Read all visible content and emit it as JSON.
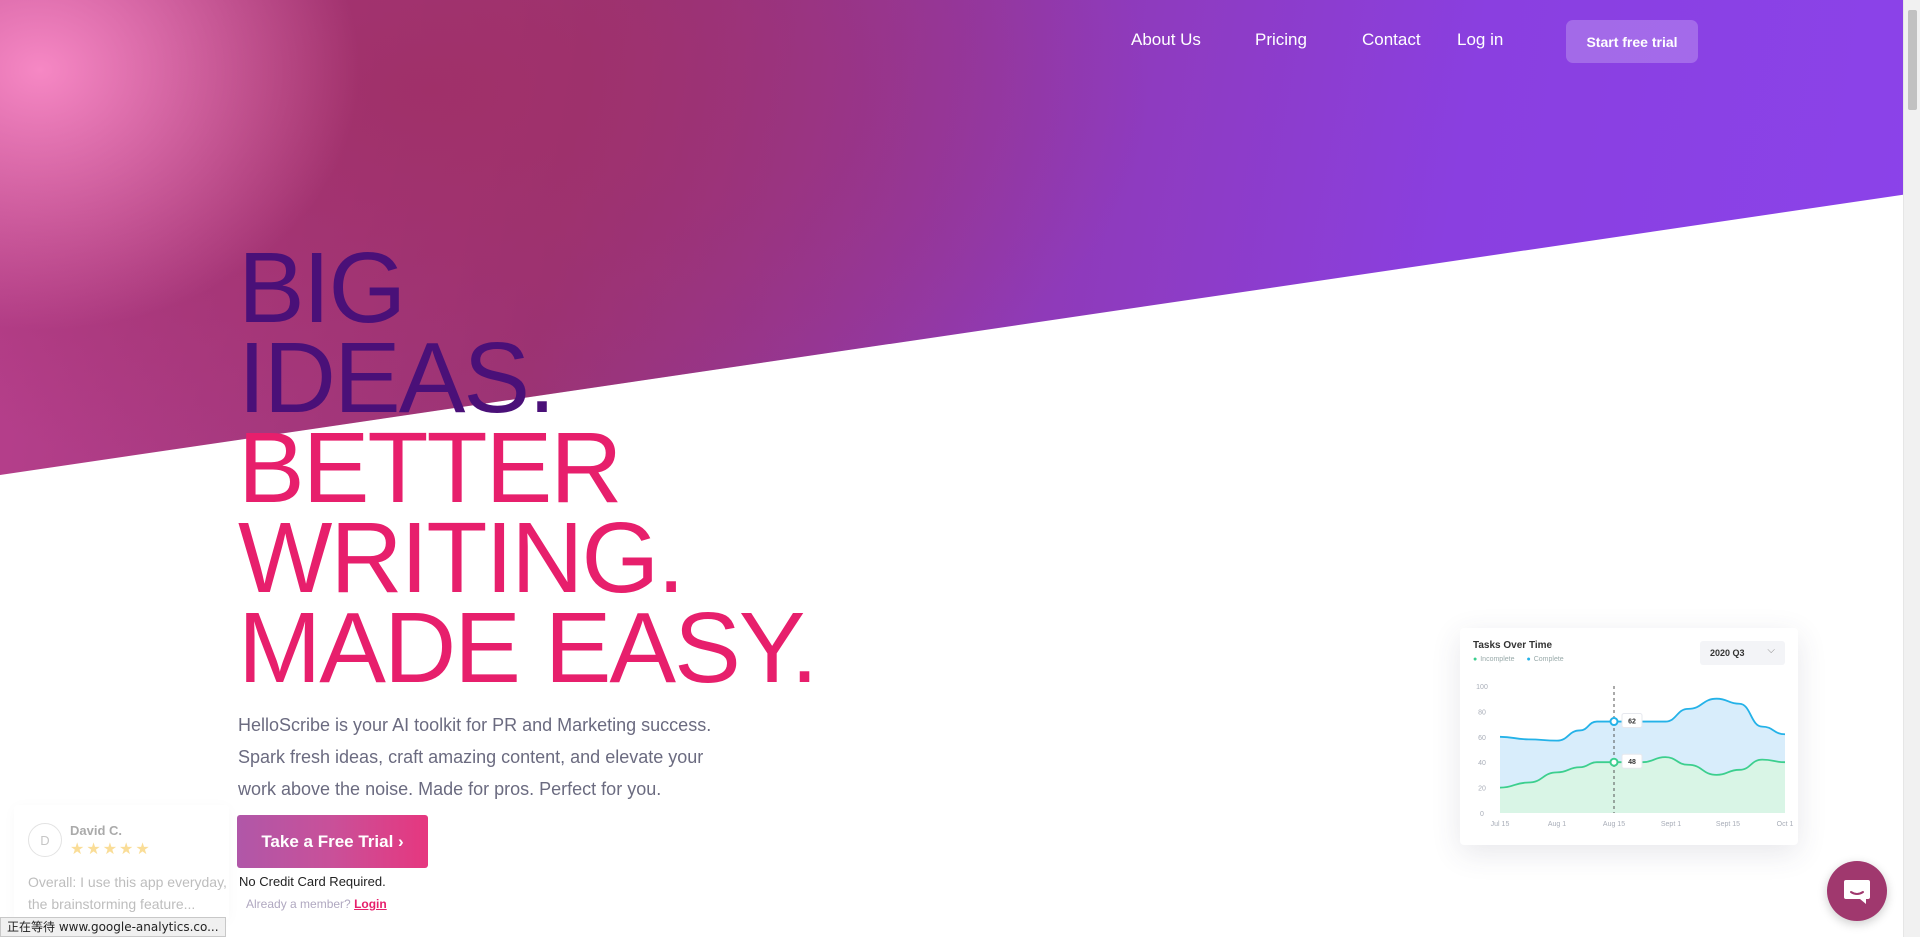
{
  "nav": {
    "items": [
      {
        "label": "About Us"
      },
      {
        "label": "Pricing"
      },
      {
        "label": "Contact"
      },
      {
        "label": "Log in"
      }
    ],
    "cta_label": "Start free trial"
  },
  "hero": {
    "headline_dark": [
      "BIG",
      "IDEAS."
    ],
    "headline_pink": [
      "BETTER",
      "WRITING.",
      "MADE EASY."
    ],
    "subtext": "HelloScribe is your AI toolkit for PR and Marketing success. Spark fresh ideas, craft amazing content, and elevate your work above the noise. Made for pros. Perfect for you.",
    "trial_button": "Take a Free Trial ›",
    "no_credit_card": "No Credit Card Required.",
    "already_member": "Already a member?",
    "login_link": "Login"
  },
  "review": {
    "avatar_initial": "D",
    "name": "David C.",
    "stars": "★★★★★",
    "text": "Overall: I use this app everyday, the brainstorming feature..."
  },
  "status_bar": {
    "text": "正在等待 www.google-analytics.co..."
  },
  "colors": {
    "headline_dark": "#4a1078",
    "headline_pink": "#e71f6c",
    "hero_purple": "#8b43ea",
    "hero_magenta": "#9a3478",
    "chat_bubble": "#a0386e"
  },
  "chart_data": {
    "type": "area",
    "title": "Tasks Over Time",
    "selector": "2020 Q3",
    "legend": [
      "Incomplete",
      "Complete"
    ],
    "categories": [
      "Jul 15",
      "Aug 1",
      "Aug 15",
      "Sept 1",
      "Sept 15",
      "Oct 1"
    ],
    "y_ticks": [
      "0",
      "20",
      "40",
      "60",
      "80",
      "100"
    ],
    "ylim": [
      0,
      100
    ],
    "series": [
      {
        "name": "Complete",
        "color": "#24b2e8",
        "x": [
          0,
          0.5,
          1,
          1.4,
          1.7,
          2.5,
          2.9,
          3.3,
          3.8,
          4.2,
          4.6,
          5
        ],
        "values": [
          60,
          58,
          57,
          65,
          72,
          72,
          72,
          82,
          90,
          86,
          68,
          62
        ]
      },
      {
        "name": "Incomplete",
        "color": "#3ccf8e",
        "x": [
          0,
          0.5,
          1,
          1.4,
          1.7,
          2.5,
          2.9,
          3.3,
          3.8,
          4.2,
          4.6,
          5
        ],
        "values": [
          20,
          24,
          32,
          36,
          40,
          40,
          44,
          38,
          30,
          34,
          42,
          40
        ]
      }
    ],
    "annotations": [
      {
        "x_category": "Aug 15",
        "series": "Complete",
        "label": "62"
      },
      {
        "x_category": "Aug 15",
        "series": "Incomplete",
        "label": "48"
      }
    ]
  }
}
